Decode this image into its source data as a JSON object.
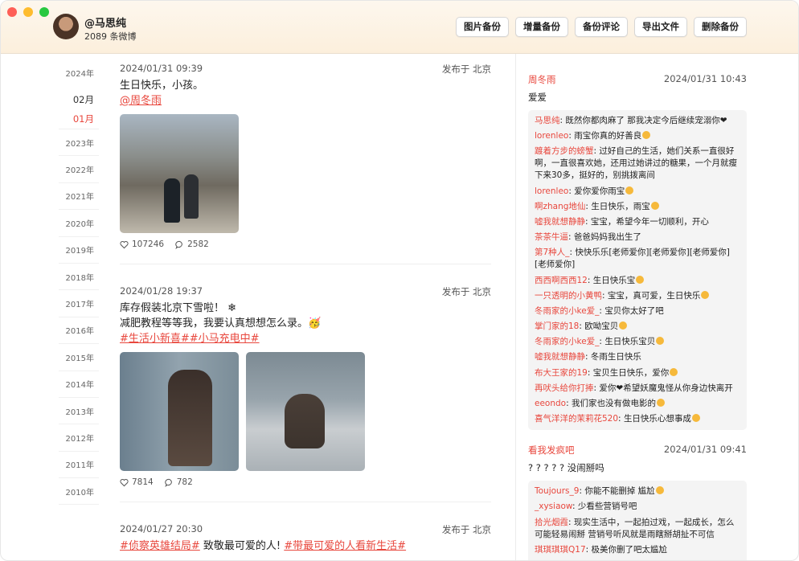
{
  "header": {
    "user_name": "@马思纯",
    "post_count": "2089 条微博",
    "buttons": [
      "图片备份",
      "增量备份",
      "备份评论",
      "导出文件",
      "删除备份"
    ]
  },
  "timeline": {
    "year_2024": "2024年",
    "months": [
      "02月",
      "01月"
    ],
    "years": [
      "2023年",
      "2022年",
      "2021年",
      "2020年",
      "2019年",
      "2018年",
      "2017年",
      "2016年",
      "2015年",
      "2014年",
      "2013年",
      "2012年",
      "2011年",
      "2010年"
    ]
  },
  "posts": [
    {
      "time": "2024/01/31 09:39",
      "location": "发布于 北京",
      "text": "生日快乐，小孩。",
      "mention": "@周冬雨",
      "likes": "107246",
      "comments": "2582"
    },
    {
      "time": "2024/01/28 19:37",
      "location": "发布于 北京",
      "line1": "库存假装北京下雪啦！ ❄",
      "line2": "减肥教程等等我，我要认真想想怎么录。🥳",
      "topic": "#生活小新喜##小马充电中#",
      "likes": "7814",
      "comments": "782"
    },
    {
      "time": "2024/01/27 20:30",
      "location": "发布于 北京",
      "topic1": "#侦察英雄结局#",
      "middle": " 致敬最可爱的人! ",
      "topic2": "#带最可爱的人看新生活#"
    }
  ],
  "comment_threads": [
    {
      "author": "周冬雨",
      "time": "2024/01/31 10:43",
      "text": "爱爱",
      "replies": [
        {
          "author": "马思纯",
          "text": "既然你都肉麻了 那我决定今后继续宠溺你❤"
        },
        {
          "author": "lorenleo",
          "text": "雨宝你真的好善良"
        },
        {
          "author": "踱着方步的螃蟹",
          "text": "过好自己的生活，她们关系一直很好啊，一直很喜欢她，还用过她讲过的糖果，一个月就瘦下来30多，挺好的，别挑拨离间"
        },
        {
          "author": "lorenleo",
          "text": "爱你爱你雨宝"
        },
        {
          "author": "啊zhang地仙",
          "text": "生日快乐，雨宝"
        },
        {
          "author": "嘘我就想静静",
          "text": "宝宝，希望今年一切顺利，开心"
        },
        {
          "author": "茶茶牛逼",
          "text": "爸爸妈妈我出生了"
        },
        {
          "author": "第7种人_",
          "text": "快快乐乐[老师爱你][老师爱你][老师爱你][老师爱你]"
        },
        {
          "author": "西西啊西西12",
          "text": "生日快乐宝"
        },
        {
          "author": "一只透明的小黄鸭",
          "text": "宝宝，真可爱，生日快乐"
        },
        {
          "author": "冬雨家的小ke爱_",
          "text": "宝贝你太好了吧"
        },
        {
          "author": "掌门家的18",
          "text": "欧呦宝贝"
        },
        {
          "author": "冬雨家的小ke爱_",
          "text": "生日快乐宝贝"
        },
        {
          "author": "嘘我就想静静",
          "text": "冬雨生日快乐"
        },
        {
          "author": "布大王家的19",
          "text": "宝贝生日快乐，爱你"
        },
        {
          "author": "再吠头给你打捧",
          "text": "爱你❤希望妖魔鬼怪从你身边快离开"
        },
        {
          "author": "eeondo",
          "text": "我们家也没有做电影的"
        },
        {
          "author": "喜气洋洋的茉莉花520",
          "text": "生日快乐心想事成"
        }
      ]
    },
    {
      "author": "看我发疯吧",
      "time": "2024/01/31 09:41",
      "text": "? ? ? ? ? 没闹掰吗",
      "replies": [
        {
          "author": "Toujours_9",
          "text": "你能不能删掉 尴尬"
        },
        {
          "author": "_xysiaow",
          "text": "少看些营销号吧"
        },
        {
          "author": "拾光烟霞",
          "text": "现实生活中，一起拍过戏，一起成长，怎么可能轻易闹掰 营销号听风就是雨瞎掰胡扯不可信"
        },
        {
          "author": "琪琪琪琪Q17",
          "text": "极美你删了吧太尴尬"
        }
      ]
    }
  ]
}
